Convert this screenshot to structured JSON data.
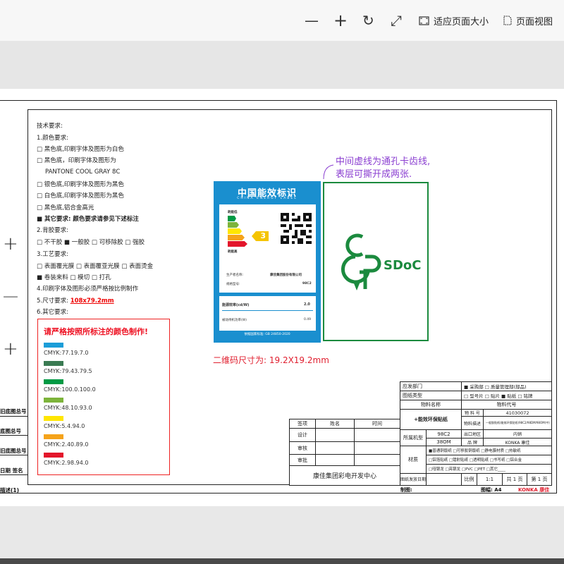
{
  "toolbar": {
    "minus": "—",
    "plus": "+",
    "rotate": "↻",
    "expand": "⤢",
    "fit_label": "适应页面大小",
    "view_label": "页面视图"
  },
  "requirements": {
    "title": "技术要求:",
    "color_heading": "1.颜色要求:",
    "c1": "□ 黑色底,印刷字体及图形为白色",
    "c2": "□ 黑色底，印刷字体及图形为",
    "c2b": "PANTONE COOL GRAY 8C",
    "c3": "□ 银色底,印刷字体及图形为黑色",
    "c4": "□ 白色底,印刷字体及图形为黑色",
    "c5": "□ 黑色底,铝合金高光",
    "c6": "■ 其它要求: 颜色要求请参见下述标注",
    "glue_heading": "2.背胶要求:",
    "glue": "□ 不干胶  ■ 一般胶  □ 可移除胶  □ 强胶",
    "process_heading": "3.工艺要求:",
    "p1": "□ 表面覆光膜  □ 表面覆亚光膜  □ 表面烫金",
    "p2": "■ 卷装来料   □ 模切   □ 打孔",
    "print": "4.印刷字体及图形必须严格按比例制作",
    "size_prefix": "5.尺寸要求: ",
    "size_value": "108x79.2mm",
    "other": "6.其它要求:"
  },
  "colorbox": {
    "title": "请严格按照所标注的颜色制作!",
    "items": [
      {
        "color": "#1b9dd8",
        "cmyk": "CMYK:77.19.7.0"
      },
      {
        "color": "#3a7a52",
        "cmyk": "CMYK:79.43.79.5"
      },
      {
        "color": "#009a44",
        "cmyk": "CMYK:100.0.100.0"
      },
      {
        "color": "#7db43b",
        "cmyk": "CMYK:48.10.93.0"
      },
      {
        "color": "#ffe600",
        "cmyk": "CMYK:5.4.94.0"
      },
      {
        "color": "#f5a31a",
        "cmyk": "CMYK:2.40.89.0"
      },
      {
        "color": "#e3162b",
        "cmyk": "CMYK:2.98.94.0"
      }
    ]
  },
  "left_labels": [
    "旧底图总号",
    "底图总号",
    "旧底图总号",
    "日期  签名",
    "描述(1)"
  ],
  "energy_label": {
    "title": "中国能效标识",
    "subtitle": "CHINA ENERGY LABEL",
    "low": "耗能低",
    "high": "耗能高",
    "grade": "3",
    "producer_label": "生产者名称:",
    "producer": "康佳集团股份有限公司",
    "model_label": "规格型号:",
    "model": "98C2",
    "eff_label": "能源效率(cd/W)",
    "eff_value": "2.0",
    "standby_label": "被动待机功率(W)",
    "standby_value": "0.49",
    "standard": "依据国家标准: GB 24850-2020"
  },
  "sdoc": "SDoC",
  "notes": {
    "purple1": "中间虚线为通孔卡齿线,",
    "purple2": "表层可撕开成两张.",
    "qr_size": "二维码尺寸为: 19.2X19.2mm"
  },
  "signoff": {
    "col_sign": "签项",
    "col_name": "姓名",
    "col_time": "时间",
    "rows": [
      "设计",
      "审核",
      "审批"
    ],
    "company": "康佳集团彩电开发中心"
  },
  "titleblock": {
    "dept_label": "应发部门",
    "dept_value": "■ 采购部 □ 质量管理部(部品)",
    "type_label": "图纸类型",
    "type_value": "□ 型号片 □ 贴片 ■ 贴纸 □ 铭牌",
    "name_label": "物料名称",
    "code_label": "物料代号",
    "product_name": "+能效环保贴纸",
    "mat_code_label": "物 料 号",
    "mat_code": "41030072",
    "mat_desc_label": "物料描述",
    "mat_desc": "一般胶贴纸(能效环保贴纸)98C2/98DM/98OM(中)",
    "region_label": "出口地区",
    "region": "内销",
    "brand_label": "品  牌",
    "brand": "KONKA 康佳",
    "model_group_label": "所属机型",
    "model_1": "98C2",
    "model_2": "38OM",
    "material_label": "材质",
    "mat_row1": "■普通铜版纸 □可移胶铜版纸 □静电膜材质 □热敏纸",
    "mat_row2": "□铝箔贴纸 □镭射贴纸 □透明贴纸 □书写纸 □铝合金",
    "mat_row3": "□哑银龙 □亮银龙 □PVC □PET □其它____",
    "date_label": "图纸发放日期",
    "scale_label": "比例",
    "scale": "1:1",
    "pages": "共 1 页",
    "page": "第 1 页",
    "drawer": "制图:",
    "format": "图幅: A4",
    "konka": "KONKA 康佳"
  }
}
